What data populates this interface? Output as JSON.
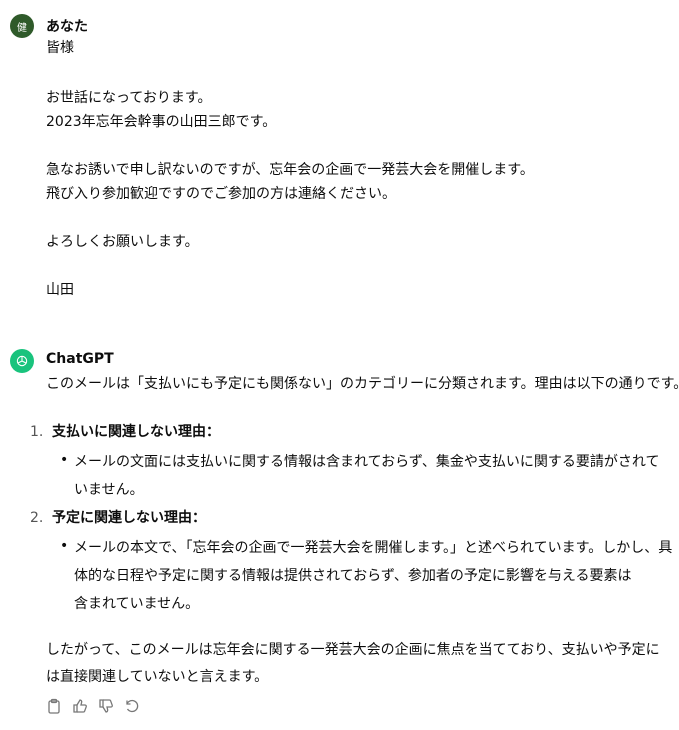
{
  "user_message": {
    "author": "あなた",
    "avatar_text": "健",
    "lines": [
      "皆様",
      "",
      "お世話になっております。",
      "2023年忘年会幹事の山田三郎です。",
      "",
      "急なお誘いで申し訳ないのですが、忘年会の企画で一発芸大会を開催します。",
      "飛び入り参加歓迎ですのでご参加の方は連絡ください。",
      "",
      "よろしくお願いします。",
      "",
      "山田"
    ]
  },
  "assistant_message": {
    "author": "ChatGPT",
    "intro": "このメールは「支払いにも予定にも関係ない」のカテゴリーに分類されます。理由は以下の通りです。",
    "items": [
      {
        "number": "1.",
        "title": "支払いに関連しない理由：",
        "bullet_lines": [
          "メールの文面には支払いに関する情報は含まれておらず、集金や支払いに関する要請がされて",
          "いません。"
        ]
      },
      {
        "number": "2.",
        "title": "予定に関連しない理由：",
        "bullet_lines": [
          "メールの本文で、「忘年会の企画で一発芸大会を開催します。」と述べられています。しかし、具",
          "体的な日程や予定に関する情報は提供されておらず、参加者の予定に影響を与える要素は",
          "含まれていません。"
        ]
      }
    ],
    "conclusion_lines": [
      "したがって、このメールは忘年会に関する一発芸大会の企画に焦点を当てており、支払いや予定に",
      "は直接関連していないと言えます。"
    ]
  },
  "actions": [
    {
      "icon": "clipboard-icon"
    },
    {
      "icon": "thumbs-up-icon"
    },
    {
      "icon": "thumbs-down-icon"
    },
    {
      "icon": "regenerate-icon"
    }
  ]
}
